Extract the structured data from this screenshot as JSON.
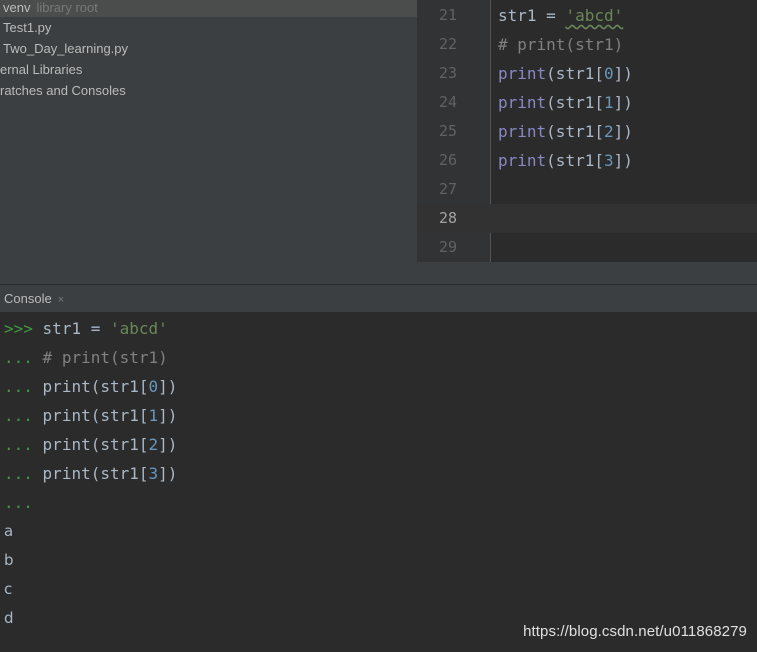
{
  "project_tree": {
    "items": [
      {
        "label": "venv",
        "hint": "library root"
      },
      {
        "label": "Test1.py"
      },
      {
        "label": "Two_Day_learning.py"
      },
      {
        "label": "ernal Libraries"
      },
      {
        "label": "ratches and Consoles"
      }
    ]
  },
  "editor": {
    "line_numbers": [
      "21",
      "22",
      "23",
      "24",
      "25",
      "26",
      "27",
      "28",
      "29"
    ],
    "lines": [
      {
        "var": "str1 = ",
        "str": "'abcd'"
      },
      {
        "comment": "# print(str1)"
      },
      {
        "fn": "print",
        "pre": "(str1[",
        "num": "0",
        "post": "])"
      },
      {
        "fn": "print",
        "pre": "(str1[",
        "num": "1",
        "post": "])"
      },
      {
        "fn": "print",
        "pre": "(str1[",
        "num": "2",
        "post": "])"
      },
      {
        "fn": "print",
        "pre": "(str1[",
        "num": "3",
        "post": "])"
      }
    ]
  },
  "console_tab": {
    "label": "Console",
    "close": "×"
  },
  "console": {
    "prompt_primary": ">>>",
    "prompt_cont": "...",
    "input_lines": [
      {
        "a": "str1 = ",
        "s": "'abcd'"
      },
      {
        "c": "# print(str1)"
      },
      {
        "a": "print(str1[",
        "n": "0",
        "b": "])"
      },
      {
        "a": "print(str1[",
        "n": "1",
        "b": "])"
      },
      {
        "a": "print(str1[",
        "n": "2",
        "b": "])"
      },
      {
        "a": "print(str1[",
        "n": "3",
        "b": "])"
      }
    ],
    "outputs": [
      "a",
      "b",
      "c",
      "d"
    ]
  },
  "watermark": "https://blog.csdn.net/u011868279",
  "colors": {
    "background": "#2b2b2b",
    "panel": "#3c3f41",
    "string": "#6a8759",
    "number": "#6897bb",
    "builtin": "#8888c6",
    "comment": "#808080",
    "prompt": "#3f9b3f"
  }
}
